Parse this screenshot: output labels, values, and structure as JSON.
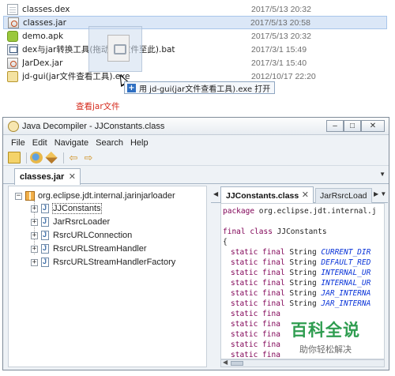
{
  "explorer": {
    "files": [
      {
        "name": "classes.dex",
        "date": "2017/5/13 20:32",
        "icon": "page-icon",
        "selected": false
      },
      {
        "name": "classes.jar",
        "date": "2017/5/13 20:58",
        "icon": "jar-icon",
        "selected": true
      },
      {
        "name": "demo.apk",
        "date": "2017/5/13 20:32",
        "icon": "apk-icon",
        "selected": false
      },
      {
        "name": "dex与jar转换工具(拖动de     文件至此).bat",
        "date": "2017/3/1 15:49",
        "icon": "batch-icon",
        "selected": false
      },
      {
        "name": "JarDex.jar",
        "date": "2017/3/1 15:40",
        "icon": "jar-icon",
        "selected": false
      },
      {
        "name": "jd-gui(jar文件查看工具).exe",
        "date": "2012/10/17 22:20",
        "icon": "exe-icon",
        "selected": false
      }
    ],
    "drop_tooltip": "用 jd-gui(jar文件查看工具).exe 打开",
    "drop_tooltip_icon": "plus-icon",
    "selected_color": "#dbe7f7"
  },
  "caption": "查看jar文件",
  "caption_color": "#d52a1c",
  "window": {
    "title": "Java Decompiler - JJConstants.class",
    "buttons": {
      "minimize": "–",
      "maximize": "□",
      "close": "✕"
    },
    "menu": [
      "File",
      "Edit",
      "Navigate",
      "Search",
      "Help"
    ],
    "toolbar_icons": [
      "open-file-icon",
      "browse-icon",
      "search-icon",
      "back-arrow-icon",
      "forward-arrow-icon"
    ],
    "toolbar_glyphs": {
      "back": "⇦",
      "forward": "⇨"
    },
    "doc_tab": {
      "label": "classes.jar",
      "close": "✕",
      "strip_menu": "▼"
    },
    "tree": {
      "package": "org.eclipse.jdt.internal.jarinjarloader",
      "expander_open": "−",
      "expander_closed": "+",
      "classes": [
        "JJConstants",
        "JarRsrcLoader",
        "RsrcURLConnection",
        "RsrcURLStreamHandler",
        "RsrcURLStreamHandlerFactory"
      ]
    },
    "source": {
      "tab_left_glyph": "◀",
      "active_tab": "JJConstants.class",
      "active_close": "✕",
      "other_tab": "JarRsrcLoad",
      "tab_right_glyph": "▶ ▼",
      "code": {
        "package_kw": "package",
        "package_rest": " org.eclipse.jdt.internal.j",
        "class_kw": "final class",
        "class_name": " JJConstants",
        "open_brace": "{",
        "static_final": "static final",
        "string_type": " String ",
        "fields": [
          "CURRENT_DIR",
          "DEFAULT_RED",
          "INTERNAL_UR",
          "INTERNAL_UR",
          "JAR_INTERNA",
          "JAR_INTERNA"
        ],
        "partial_kw": "static fina"
      },
      "scroll_left": "◀"
    }
  },
  "watermark": {
    "title": "百科全说",
    "subtitle": "助你轻松解决",
    "color": "#2f9d50"
  }
}
